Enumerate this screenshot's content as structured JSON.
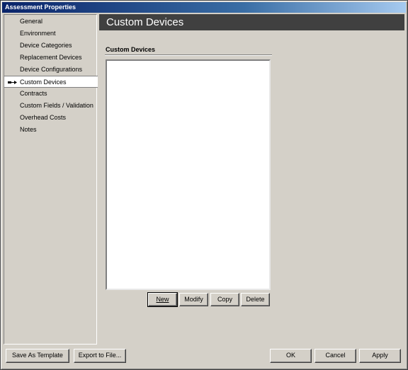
{
  "window": {
    "title": "Assessment Properties"
  },
  "nav": {
    "items": [
      {
        "label": "General"
      },
      {
        "label": "Environment"
      },
      {
        "label": "Device Categories"
      },
      {
        "label": "Replacement Devices"
      },
      {
        "label": "Device Configurations"
      },
      {
        "label": "Custom Devices",
        "selected": true
      },
      {
        "label": "Contracts"
      },
      {
        "label": "Custom Fields / Validation"
      },
      {
        "label": "Overhead Costs"
      },
      {
        "label": "Notes"
      }
    ]
  },
  "main": {
    "header_title": "Custom Devices",
    "section_label": "Custom Devices",
    "list_items": [],
    "buttons": {
      "new": "New",
      "modify": "Modify",
      "copy": "Copy",
      "delete": "Delete"
    }
  },
  "footer": {
    "save_as_template": "Save As Template",
    "export_to_file": "Export to File...",
    "ok": "OK",
    "cancel": "Cancel",
    "apply": "Apply"
  },
  "colors": {
    "dialog_bg": "#d4d0c8",
    "titlebar_start": "#0a246a",
    "titlebar_end": "#a6caf0",
    "header_bg": "#404040"
  }
}
